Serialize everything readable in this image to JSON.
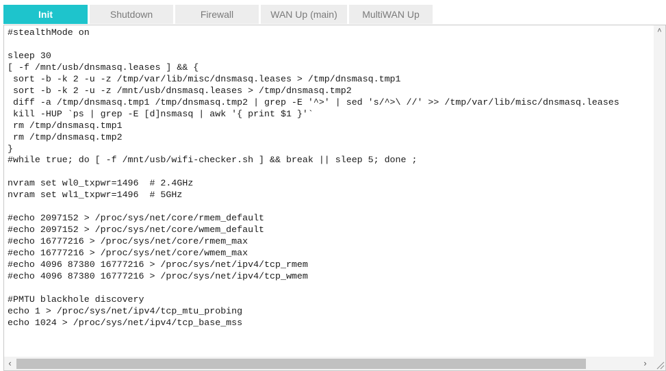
{
  "tabs": [
    {
      "label": "Init",
      "active": true
    },
    {
      "label": "Shutdown",
      "active": false
    },
    {
      "label": "Firewall",
      "active": false
    },
    {
      "label": "WAN Up (main)",
      "active": false
    },
    {
      "label": "MultiWAN Up",
      "active": false
    }
  ],
  "editor": {
    "code": "#stealthMode on\n\nsleep 30\n[ -f /mnt/usb/dnsmasq.leases ] && {\n sort -b -k 2 -u -z /tmp/var/lib/misc/dnsmasq.leases > /tmp/dnsmasq.tmp1\n sort -b -k 2 -u -z /mnt/usb/dnsmasq.leases > /tmp/dnsmasq.tmp2\n diff -a /tmp/dnsmasq.tmp1 /tmp/dnsmasq.tmp2 | grep -E '^>' | sed 's/^>\\ //' >> /tmp/var/lib/misc/dnsmasq.leases\n kill -HUP `ps | grep -E [d]nsmasq | awk '{ print $1 }'`\n rm /tmp/dnsmasq.tmp1\n rm /tmp/dnsmasq.tmp2\n}\n#while true; do [ -f /mnt/usb/wifi-checker.sh ] && break || sleep 5; done ;\n\nnvram set wl0_txpwr=1496  # 2.4GHz\nnvram set wl1_txpwr=1496  # 5GHz\n\n#echo 2097152 > /proc/sys/net/core/rmem_default\n#echo 2097152 > /proc/sys/net/core/wmem_default\n#echo 16777216 > /proc/sys/net/core/rmem_max\n#echo 16777216 > /proc/sys/net/core/wmem_max\n#echo 4096 87380 16777216 > /proc/sys/net/ipv4/tcp_rmem\n#echo 4096 87380 16777216 > /proc/sys/net/ipv4/tcp_wmem\n\n#PMTU blackhole discovery\necho 1 > /proc/sys/net/ipv4/tcp_mtu_probing\necho 1024 > /proc/sys/net/ipv4/tcp_base_mss",
    "scroll_up_icon": "chevron-up-icon",
    "scroll_left_icon": "chevron-left-icon",
    "scroll_right_icon": "chevron-right-icon",
    "resize_icon": "resize-grip-icon"
  },
  "colors": {
    "active_tab": "#1ec4cc",
    "inactive_tab": "#ededed"
  }
}
